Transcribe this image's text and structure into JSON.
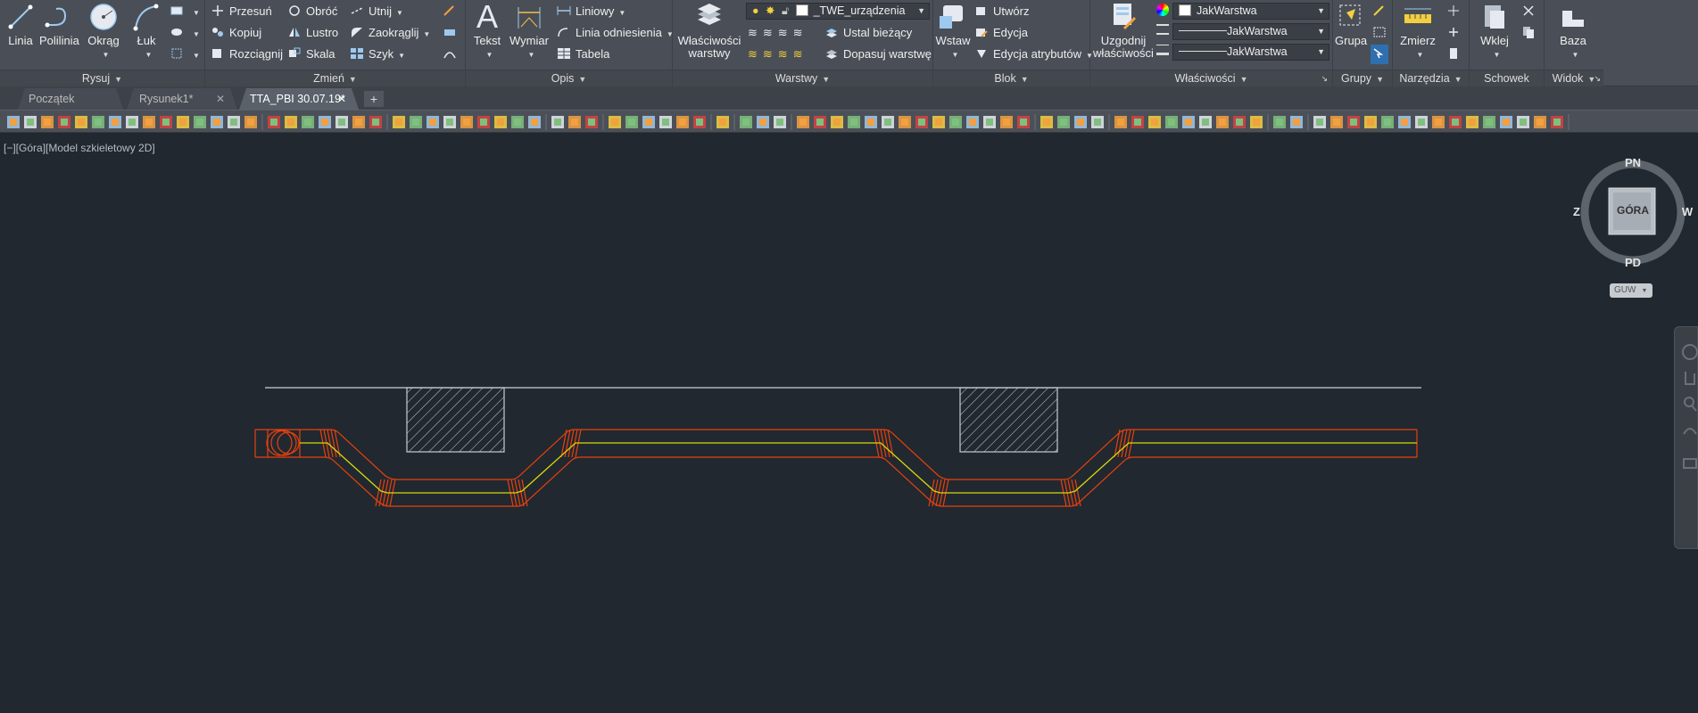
{
  "ribbon": {
    "draw": {
      "title": "Rysuj",
      "linia": "Linia",
      "polilinia": "Polilinia",
      "okrag": "Okrąg",
      "luk": "Łuk"
    },
    "modify": {
      "title": "Zmień",
      "items": [
        "Przesuń",
        "Obróć",
        "Utnij",
        "Kopiuj",
        "Lustro",
        "Zaokrąglij",
        "Rozciągnij",
        "Skala",
        "Szyk"
      ]
    },
    "annotation": {
      "title": "Opis",
      "tekst": "Tekst",
      "wymiar": "Wymiar",
      "liniowy": "Liniowy",
      "linia_odniesienia": "Linia odniesienia",
      "tabela": "Tabela"
    },
    "layers": {
      "title": "Warstwy",
      "wlasciwosci_1": "Właściwości",
      "wlasciwosci_2": "warstwy",
      "current_layer": "_TWE_urządzenia",
      "ustal_biezacy": "Ustal bieżący",
      "dopasuj_warstwe": "Dopasuj warstwę"
    },
    "block": {
      "title": "Blok",
      "wstaw": "Wstaw",
      "utworz": "Utwórz",
      "edycja": "Edycja",
      "edycja_atrybutow": "Edycja atrybutów"
    },
    "properties": {
      "title": "Właściwości",
      "uzgodnij_1": "Uzgodnij",
      "uzgodnij_2": "właściwości",
      "color": "JakWarstwa",
      "linetype": "JakWarstwa",
      "lineweight": "JakWarstwa"
    },
    "groups": {
      "title": "Grupy",
      "grupa": "Grupa"
    },
    "utilities": {
      "title": "Narzędzia",
      "zmierz": "Zmierz"
    },
    "clipboard": {
      "title": "Schowek",
      "wklej": "Wklej"
    },
    "view": {
      "title": "Widok",
      "baza": "Baza"
    }
  },
  "doc_tabs": [
    {
      "label": "Początek"
    },
    {
      "label": "Rysunek1*"
    },
    {
      "label": "TTA_PBI 30.07.19*"
    }
  ],
  "viewport": {
    "label": "[−][Góra][Model szkieletowy 2D]",
    "viewcube": {
      "face": "GÓRA",
      "north": "PN",
      "south": "PD",
      "west": "Z",
      "east": "W",
      "ucs": "GUW"
    }
  },
  "colors": {
    "background": "#212830",
    "pipe_outline": "#e8400c",
    "pipe_axis": "#d8d80a",
    "obstacle": "#c8ccd2",
    "ground_line": "#d0d0d0"
  }
}
